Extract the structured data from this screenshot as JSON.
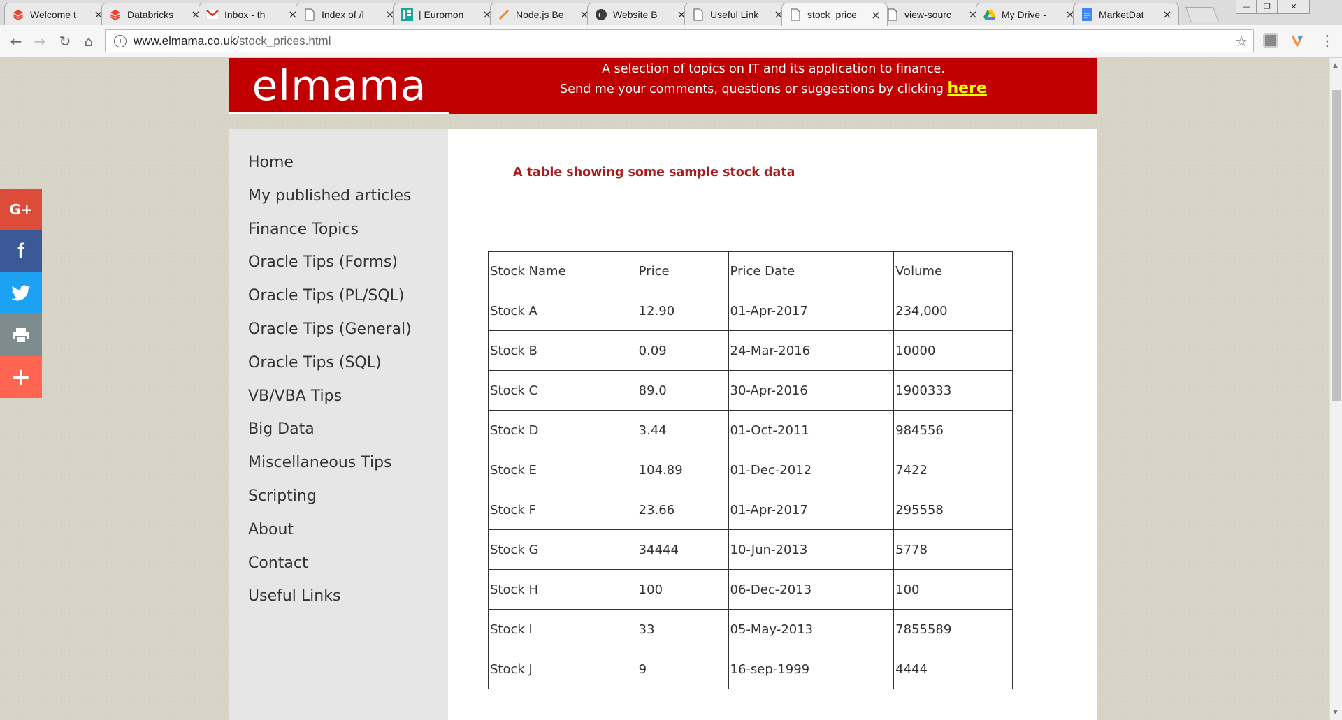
{
  "browser": {
    "tabs": [
      {
        "title": "Welcome t",
        "icon": "databricks-icon"
      },
      {
        "title": "Databricks",
        "icon": "databricks-icon"
      },
      {
        "title": "Inbox - th",
        "icon": "gmail-icon"
      },
      {
        "title": "Index of /l",
        "icon": "page-icon"
      },
      {
        "title": "| Euromon",
        "icon": "euromoney-icon"
      },
      {
        "title": "Node.js Be",
        "icon": "nodejs-icon"
      },
      {
        "title": "Website B",
        "icon": "github-icon"
      },
      {
        "title": "Useful Link",
        "icon": "page-icon"
      },
      {
        "title": "stock_price",
        "icon": "page-icon"
      },
      {
        "title": "view-sourc",
        "icon": "page-icon"
      },
      {
        "title": "My Drive -",
        "icon": "drive-icon"
      },
      {
        "title": "MarketDat",
        "icon": "docs-icon"
      }
    ],
    "active_tab_index": 8,
    "url_host": "www.elmama.co.uk",
    "url_path": "/stock_prices.html"
  },
  "site": {
    "logo": "elmama",
    "tagline_line1": "A selection of topics on IT and its application to finance.",
    "tagline_line2": "Send me your comments, questions or suggestions by clicking",
    "tagline_link": "here"
  },
  "nav": [
    "Home",
    "My published articles",
    "Finance Topics",
    "Oracle Tips (Forms)",
    "Oracle Tips (PL/SQL)",
    "Oracle Tips (General)",
    "Oracle Tips (SQL)",
    "VB/VBA Tips",
    "Big Data",
    "Miscellaneous Tips",
    "Scripting",
    "About",
    "Contact",
    "Useful Links"
  ],
  "content": {
    "caption": "A table showing some sample stock data",
    "table": {
      "headers": [
        "Stock Name",
        "Price",
        "Price Date",
        "Volume"
      ],
      "rows": [
        [
          "Stock A",
          "12.90",
          "01-Apr-2017",
          "234,000"
        ],
        [
          "Stock B",
          "0.09",
          "24-Mar-2016",
          "10000"
        ],
        [
          "Stock C",
          "89.0",
          "30-Apr-2016",
          "1900333"
        ],
        [
          "Stock D",
          "3.44",
          "01-Oct-2011",
          "984556"
        ],
        [
          "Stock E",
          "104.89",
          "01-Dec-2012",
          "7422"
        ],
        [
          "Stock F",
          "23.66",
          "01-Apr-2017",
          "295558"
        ],
        [
          "Stock G",
          "34444",
          "10-Jun-2013",
          "5778"
        ],
        [
          "Stock H",
          "100",
          "06-Dec-2013",
          "100"
        ],
        [
          "Stock I",
          "33",
          "05-May-2013",
          "7855589"
        ],
        [
          "Stock J",
          "9",
          "16-sep-1999",
          "4444"
        ]
      ]
    }
  },
  "share_buttons": [
    {
      "name": "google-plus",
      "label": "G+",
      "color": "#dd4b39"
    },
    {
      "name": "facebook",
      "label": "f",
      "color": "#3b5998"
    },
    {
      "name": "twitter",
      "label": "🐦",
      "color": "#1da1f2"
    },
    {
      "name": "print",
      "label": "🖶",
      "color": "#7f8c8d"
    },
    {
      "name": "more",
      "label": "+",
      "color": "#ff6550"
    }
  ],
  "colors": {
    "banner": "#c00000",
    "link_yellow": "#ffff00",
    "caption_red": "#a81c1c",
    "sidebar_bg": "#e6e6e6"
  }
}
